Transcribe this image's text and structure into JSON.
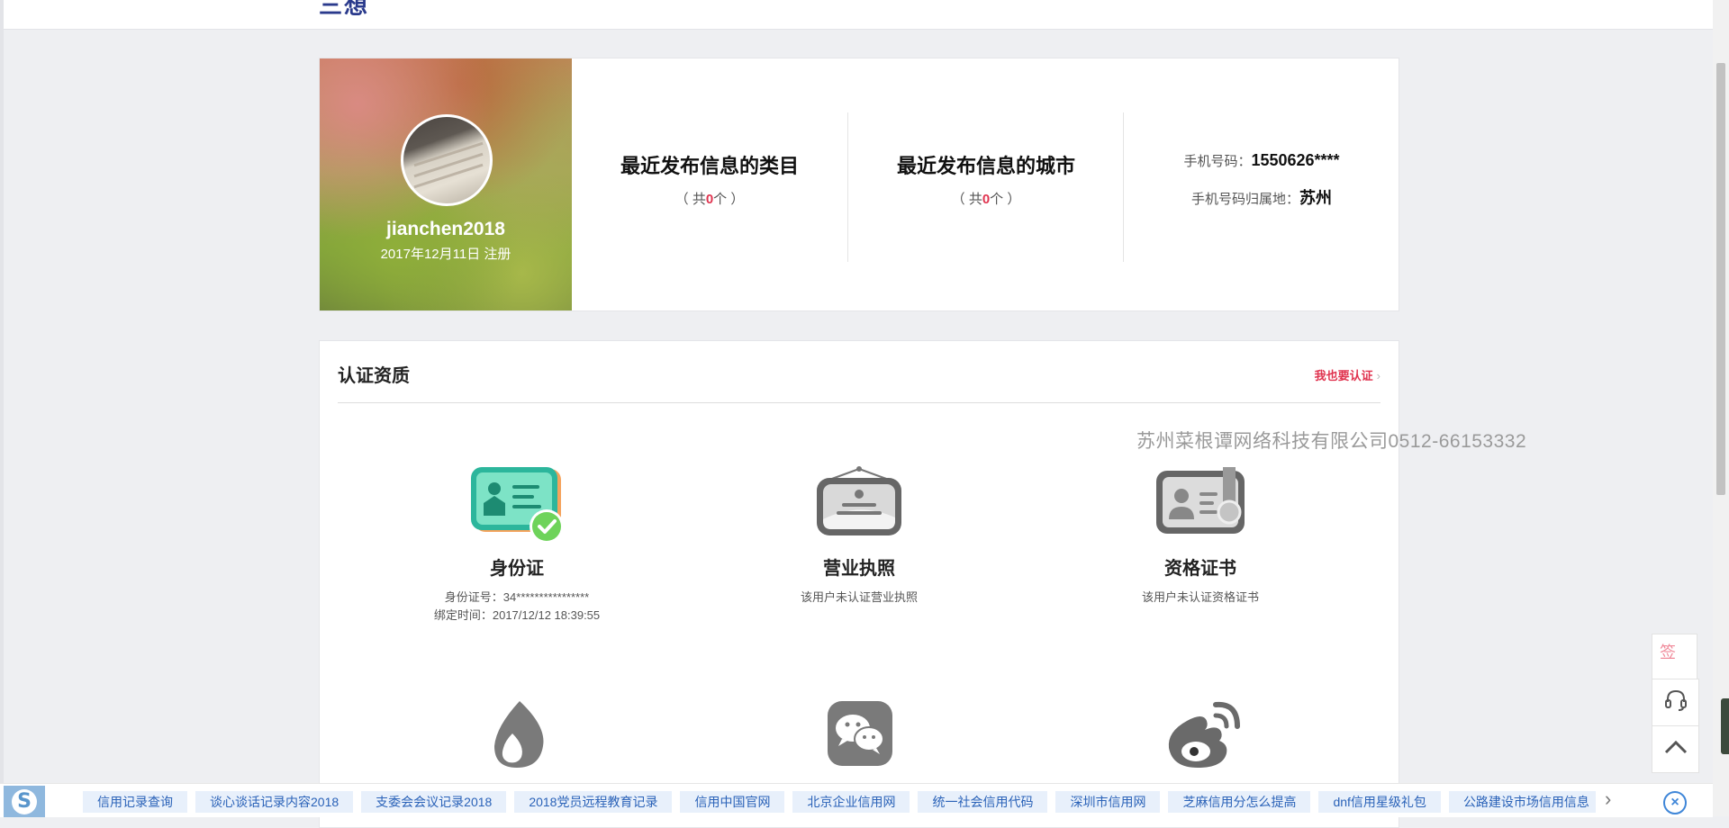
{
  "header": {
    "title_fragment": "三想"
  },
  "profile": {
    "username": "jianchen2018",
    "registered": "2017年12月11日 注册",
    "stats": [
      {
        "label": "最近发布信息的类目",
        "count_prefix": "（ 共",
        "count": "0",
        "count_suffix": "个 ）"
      },
      {
        "label": "最近发布信息的城市",
        "count_prefix": "（ 共",
        "count": "0",
        "count_suffix": "个 ）"
      }
    ],
    "phone": {
      "label": "手机号码：",
      "value": "1550626****",
      "location_label": "手机号码归属地：",
      "location_value": "苏州"
    }
  },
  "certification": {
    "title": "认证资质",
    "apply_link": "我也要认证",
    "items": [
      {
        "name": "身份证",
        "line1": "身份证号：34****************",
        "line2": "绑定时间：2017/12/12 18:39:55",
        "icon": "id-card-verified-icon"
      },
      {
        "name": "营业执照",
        "line1": "该用户未认证营业执照",
        "line2": "",
        "icon": "business-license-icon"
      },
      {
        "name": "资格证书",
        "line1": "该用户未认证资格证书",
        "line2": "",
        "icon": "qualification-certificate-icon"
      }
    ],
    "second_row_icons": [
      "flame-drop-icon",
      "wechat-icon",
      "weibo-icon"
    ]
  },
  "watermark": "苏州菜根谭网络科技有限公司0512-66153332",
  "side_tools": {
    "sign": "签",
    "service_icon": "headset-icon",
    "top_icon": "back-to-top-icon"
  },
  "bottom_bar": {
    "logo": "S",
    "tags": [
      "信用记录查询",
      "谈心谈话记录内容2018",
      "支委会会议记录2018",
      "2018党员远程教育记录",
      "信用中国官网",
      "北京企业信用网",
      "统一社会信用代码",
      "深圳市信用网",
      "芝麻信用分怎么提高",
      "dnf信用星级礼包",
      "公路建设市场信用信息"
    ]
  },
  "colors": {
    "accent": "#e0334f",
    "link_blue": "#2a62b8",
    "tag_bg": "#e8f0fb",
    "page_bg": "#eeeff2"
  }
}
